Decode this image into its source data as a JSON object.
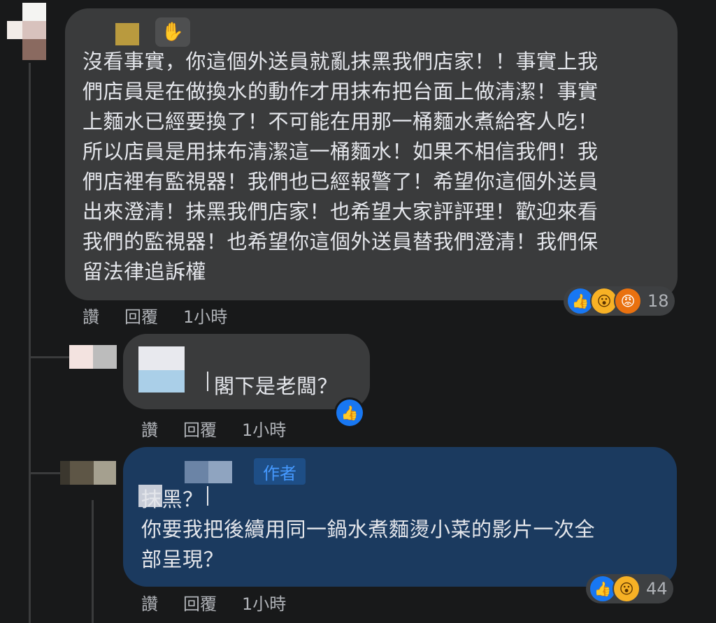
{
  "comment1": {
    "text": "沒看事實，你這個外送員就亂抹黑我們店家！！事實上我\n們店員是在做換水的動作才用抹布把台面上做清潔！事實\n上麵水已經要換了！不可能在用那一桶麵水煮給客人吃！\n所以店員是用抹布清潔這一桶麵水！如果不相信我們！我\n們店裡有監視器！我們也已經報警了！希望你這個外送員\n出來澄清！抹黑我們店家！也希望大家評評理！歡迎來看\n我們的監視器！也希望你這個外送員替我們澄清！我們保\n留法律追訴權",
    "actions": [
      "讚",
      "回覆",
      "1小時"
    ],
    "reaction_count": "18",
    "reaction_icons": [
      "like-icon",
      "wow-icon",
      "angry-icon"
    ]
  },
  "reply1": {
    "text": "閣下是老闆？",
    "actions": [
      "讚",
      "回覆",
      "1小時"
    ],
    "reaction_icons": [
      "like-icon"
    ]
  },
  "reply2": {
    "badge": "作者",
    "text": "抹黑？\n你要我把後續用同一鍋水煮麵燙小菜的影片一次全\n部呈現？",
    "actions": [
      "讚",
      "回覆",
      "1小時"
    ],
    "reaction_count": "44",
    "reaction_icons": [
      "like-icon",
      "wow-icon"
    ]
  },
  "colors": {
    "background": "#18191a",
    "bubble": "#3a3b3c",
    "author_bubble": "#1b3a5f",
    "like": "#1877f2",
    "wow": "#f7b125",
    "angry": "#e9710f"
  }
}
